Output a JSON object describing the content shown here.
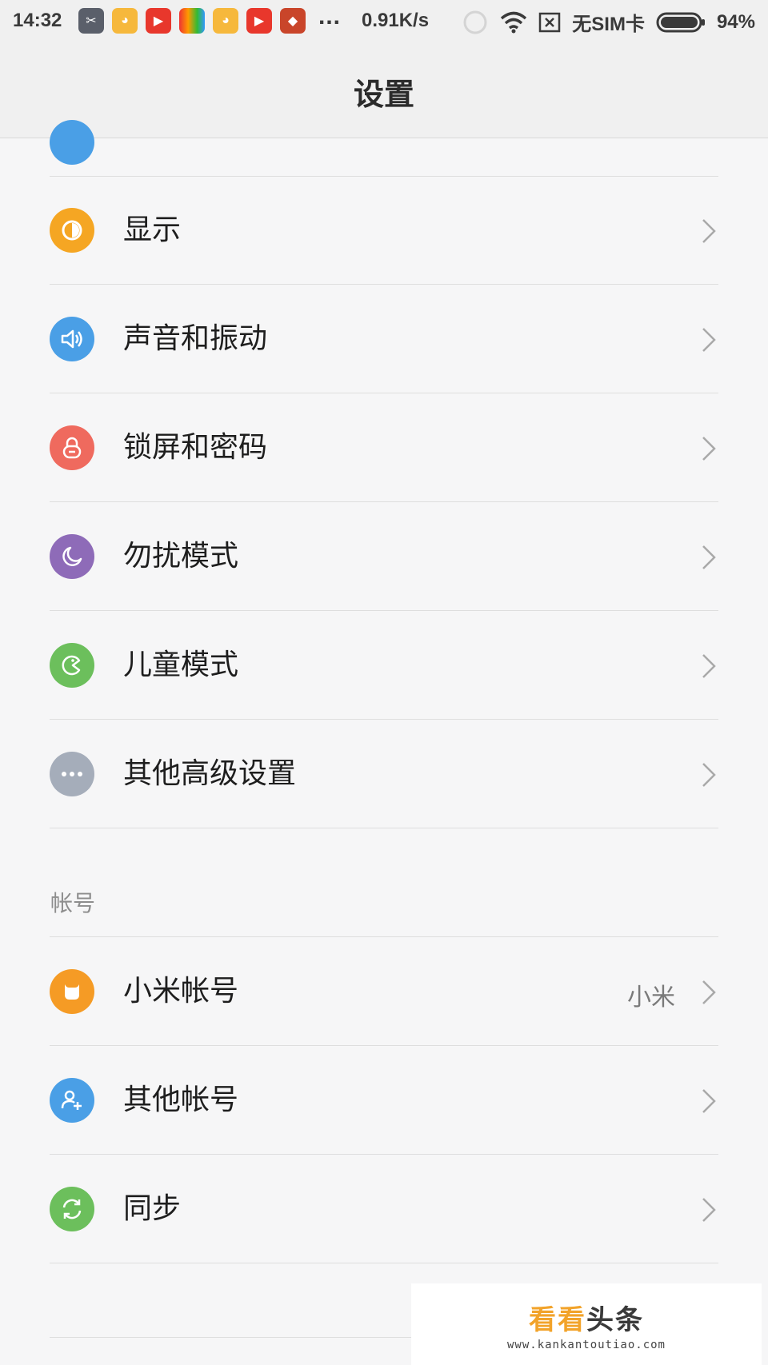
{
  "status_bar": {
    "time": "14:32",
    "more": "...",
    "net_speed": "0.91K/s",
    "sim": "无SIM卡",
    "battery": "94%",
    "icons": [
      "scissors-icon",
      "monkey-icon",
      "video-icon",
      "multicolor-app-icon",
      "monkey-icon",
      "video-icon",
      "fox-icon",
      "hd-icon",
      "wifi-icon",
      "no-sim-icon",
      "battery-icon"
    ]
  },
  "header": {
    "title": "设置"
  },
  "settings": {
    "items": [
      {
        "label": "显示",
        "icon": "display-icon",
        "color": "#f5a623"
      },
      {
        "label": "声音和振动",
        "icon": "speaker-icon",
        "color": "#4a9fe6"
      },
      {
        "label": "锁屏和密码",
        "icon": "lock-icon",
        "color": "#ef6a5e"
      },
      {
        "label": "勿扰模式",
        "icon": "moon-icon",
        "color": "#8e6bb8"
      },
      {
        "label": "儿童模式",
        "icon": "child-face-icon",
        "color": "#6cbf5c"
      },
      {
        "label": "其他高级设置",
        "icon": "more-dots-icon",
        "color": "#a5adba"
      }
    ]
  },
  "account": {
    "section_label": "帐号",
    "items": [
      {
        "label": "小米帐号",
        "value": "小米",
        "icon": "mi-icon",
        "color": "#f59b25"
      },
      {
        "label": "其他帐号",
        "icon": "add-user-icon",
        "color": "#4a9fe6"
      },
      {
        "label": "同步",
        "icon": "sync-icon",
        "color": "#6cbf5c"
      }
    ]
  },
  "watermark": {
    "brand_a": "看看",
    "brand_b": "头条",
    "url": "www.kankantoutiao.com"
  }
}
